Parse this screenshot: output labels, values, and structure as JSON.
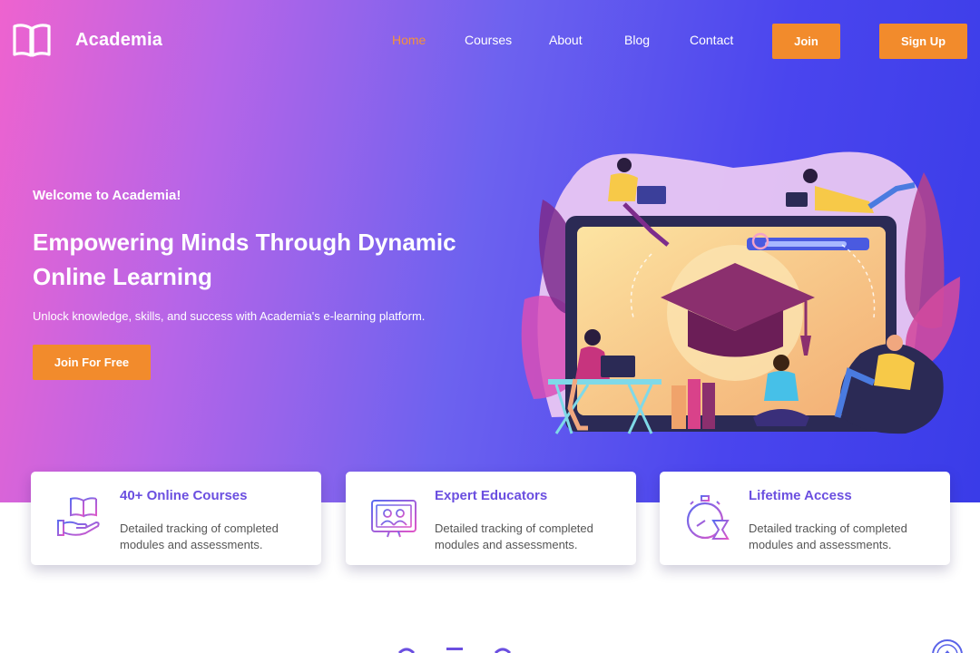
{
  "brand": {
    "name": "Academia",
    "icon": "open-book-icon"
  },
  "nav": {
    "links": [
      {
        "label": "Home",
        "active": true
      },
      {
        "label": "Courses",
        "active": false
      },
      {
        "label": "About",
        "active": false
      },
      {
        "label": "Blog",
        "active": false
      },
      {
        "label": "Contact",
        "active": false
      }
    ],
    "join_label": "Join",
    "signup_label": "Sign Up"
  },
  "hero": {
    "welcome": "Welcome to Academia!",
    "headline": "Empowering Minds Through Dynamic Online Learning",
    "subline": "Unlock knowledge, skills, and success with Academia's e-learning platform.",
    "cta_label": "Join For Free",
    "illustration": "online-learning-illustration"
  },
  "features": [
    {
      "icon": "hand-book-icon",
      "title": "40+ Online Courses",
      "text": "Detailed tracking of completed modules and assessments."
    },
    {
      "icon": "video-class-icon",
      "title": "Expert Educators",
      "text": "Detailed tracking of completed modules and assessments."
    },
    {
      "icon": "stopwatch-hourglass-icon",
      "title": "Lifetime Access",
      "text": "Detailed tracking of completed modules and assessments."
    }
  ],
  "colors": {
    "accent_orange": "#f28b2c",
    "active_link": "#f5923a",
    "card_title": "#6b4fe0",
    "gradient_start": "#ee63cf",
    "gradient_end": "#3a3ce8"
  },
  "scroll_top_icon": "arrow-up-icon"
}
